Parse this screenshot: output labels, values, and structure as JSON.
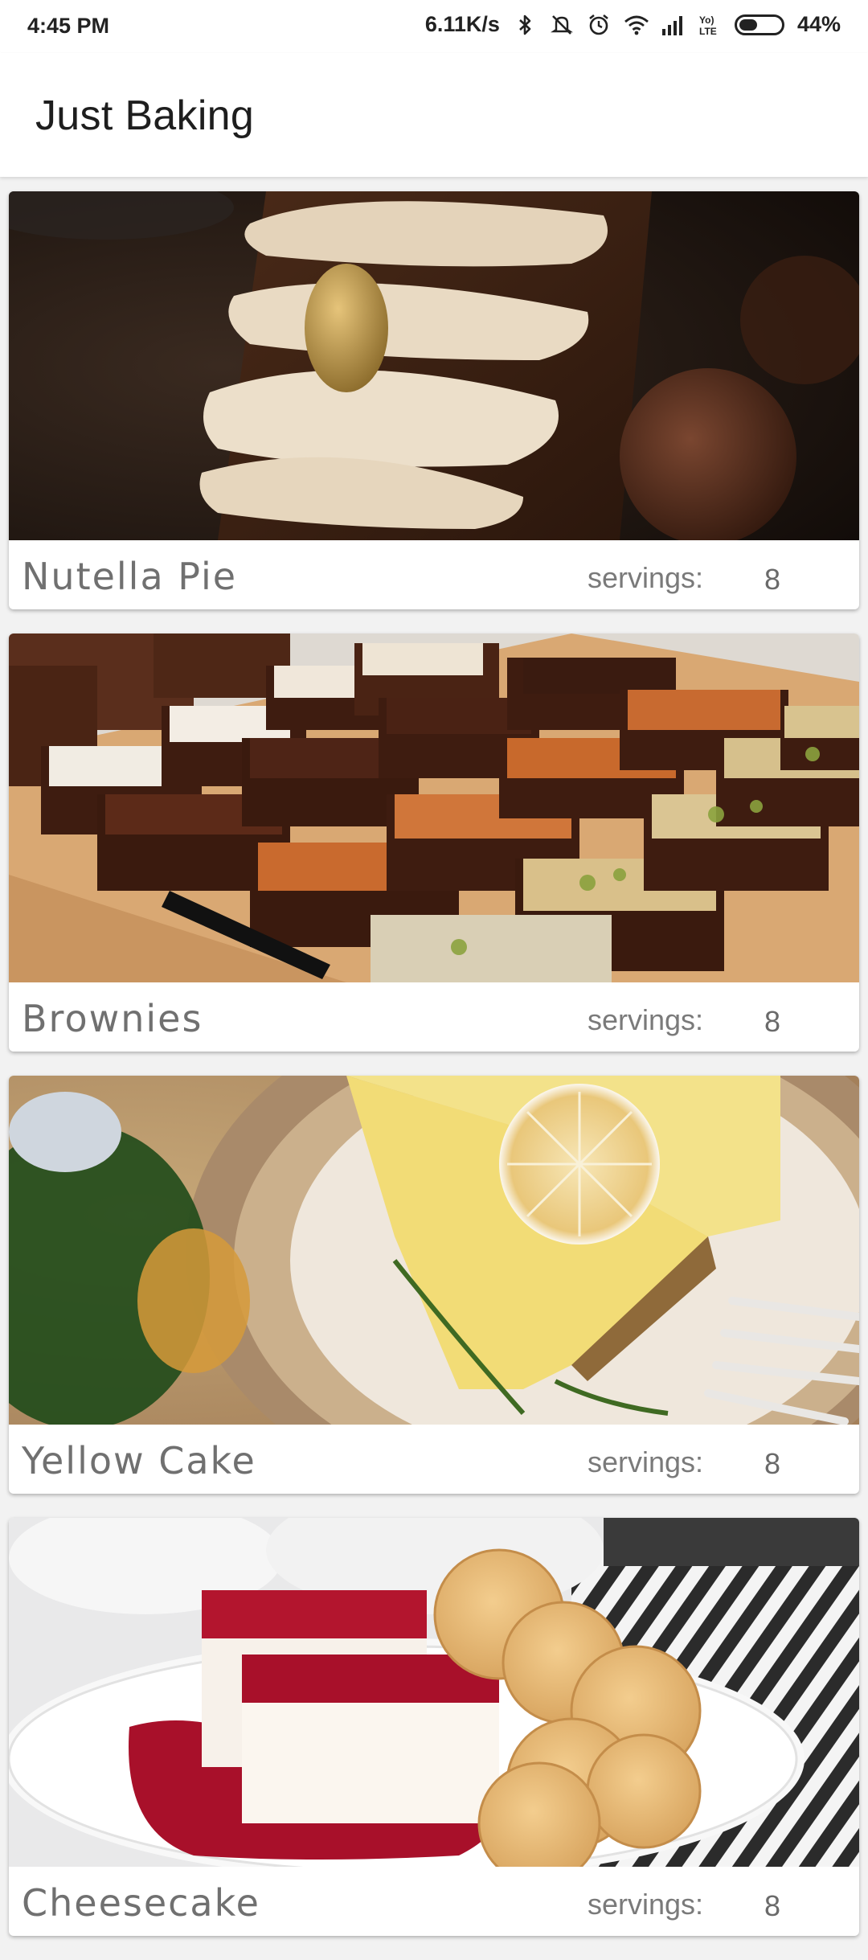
{
  "status_bar": {
    "time": "4:45 PM",
    "network_speed": "6.11K/s",
    "battery_percent": "44%",
    "battery_level": 0.44,
    "icons": [
      "bluetooth-icon",
      "mute-icon",
      "alarm-icon",
      "wifi-icon",
      "signal-icon",
      "volte-icon",
      "battery-icon"
    ]
  },
  "app_bar": {
    "title": "Just Baking"
  },
  "recipes": [
    {
      "name": "Nutella Pie",
      "servings_label": "servings:",
      "servings": "8"
    },
    {
      "name": "Brownies",
      "servings_label": "servings:",
      "servings": "8"
    },
    {
      "name": "Yellow Cake",
      "servings_label": "servings:",
      "servings": "8"
    },
    {
      "name": "Cheesecake",
      "servings_label": "servings:",
      "servings": "8"
    }
  ]
}
